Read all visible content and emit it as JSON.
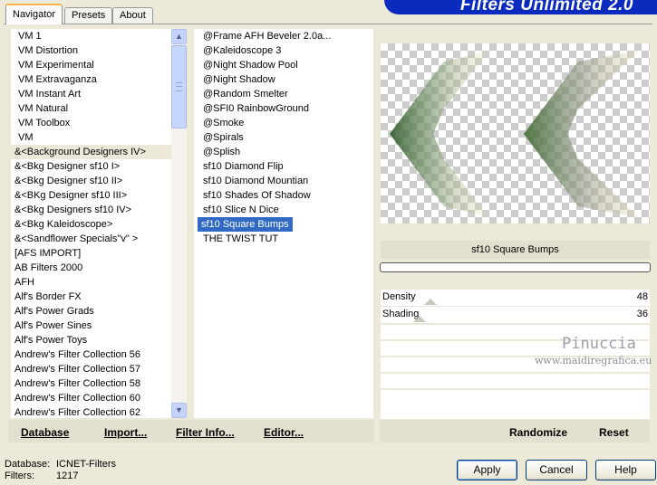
{
  "tabs": [
    {
      "label": "Navigator",
      "active": true
    },
    {
      "label": "Presets",
      "active": false
    },
    {
      "label": "About",
      "active": false
    }
  ],
  "banner_title": "Filters Unlimited 2.0",
  "categories": [
    "VM 1",
    "VM Distortion",
    "VM Experimental",
    "VM Extravaganza",
    "VM Instant Art",
    "VM Natural",
    "VM Toolbox",
    "VM",
    "&<Background Designers IV>",
    "&<Bkg Designer sf10 I>",
    "&<Bkg Designer sf10 II>",
    "&<BKg Designer sf10 III>",
    "&<Bkg Designers sf10 IV>",
    "&<Bkg Kaleidoscope>",
    "&<Sandflower Specials\"v\" >",
    "[AFS IMPORT]",
    "AB Filters 2000",
    "AFH",
    "Alf's Border FX",
    "Alf's Power Grads",
    "Alf's Power Sines",
    "Alf's Power Toys",
    "Andrew's Filter Collection 56",
    "Andrew's Filter Collection 57",
    "Andrew's Filter Collection 58",
    "Andrew's Filter Collection 60",
    "Andrew's Filter Collection 62"
  ],
  "highlighted_category": "&<Background Designers IV>",
  "filters": [
    "@Frame AFH Beveler 2.0a...",
    "@Kaleidoscope 3",
    "@Night Shadow Pool",
    "@Night Shadow",
    "@Random Smelter",
    "@SFI0 RainbowGround",
    "@Smoke",
    "@Spirals",
    "@Splish",
    "sf10 Diamond Flip",
    "sf10 Diamond Mountian",
    "sf10 Shades Of Shadow",
    "sf10 Slice N Dice",
    "sf10 Square Bumps",
    "THE TWIST TUT"
  ],
  "selected_filter": "sf10 Square Bumps",
  "left_links": {
    "database": "Database",
    "import": "Import...",
    "filter_info": "Filter Info...",
    "editor": "Editor..."
  },
  "right_links": {
    "randomize": "Randomize",
    "reset": "Reset"
  },
  "preview_filter_name": "sf10 Square Bumps",
  "params": [
    {
      "label": "Density",
      "value": "48"
    },
    {
      "label": "Shading",
      "value": "36"
    }
  ],
  "watermark": {
    "line1": "Pinuccia",
    "line2": "www.maidiregrafica.eu"
  },
  "status": {
    "db_label": "Database:",
    "db_value": "ICNET-Filters",
    "filters_label": "Filters:",
    "filters_value": "1217"
  },
  "buttons": {
    "apply": "Apply",
    "cancel": "Cancel",
    "help": "Help"
  },
  "icons": {
    "scroll_up": "chevron-up-icon",
    "scroll_down": "chevron-down-icon"
  },
  "colors": {
    "accent": "#316ac5",
    "banner": "#0b2bbe",
    "tab_highlight": "#f9b54a"
  }
}
